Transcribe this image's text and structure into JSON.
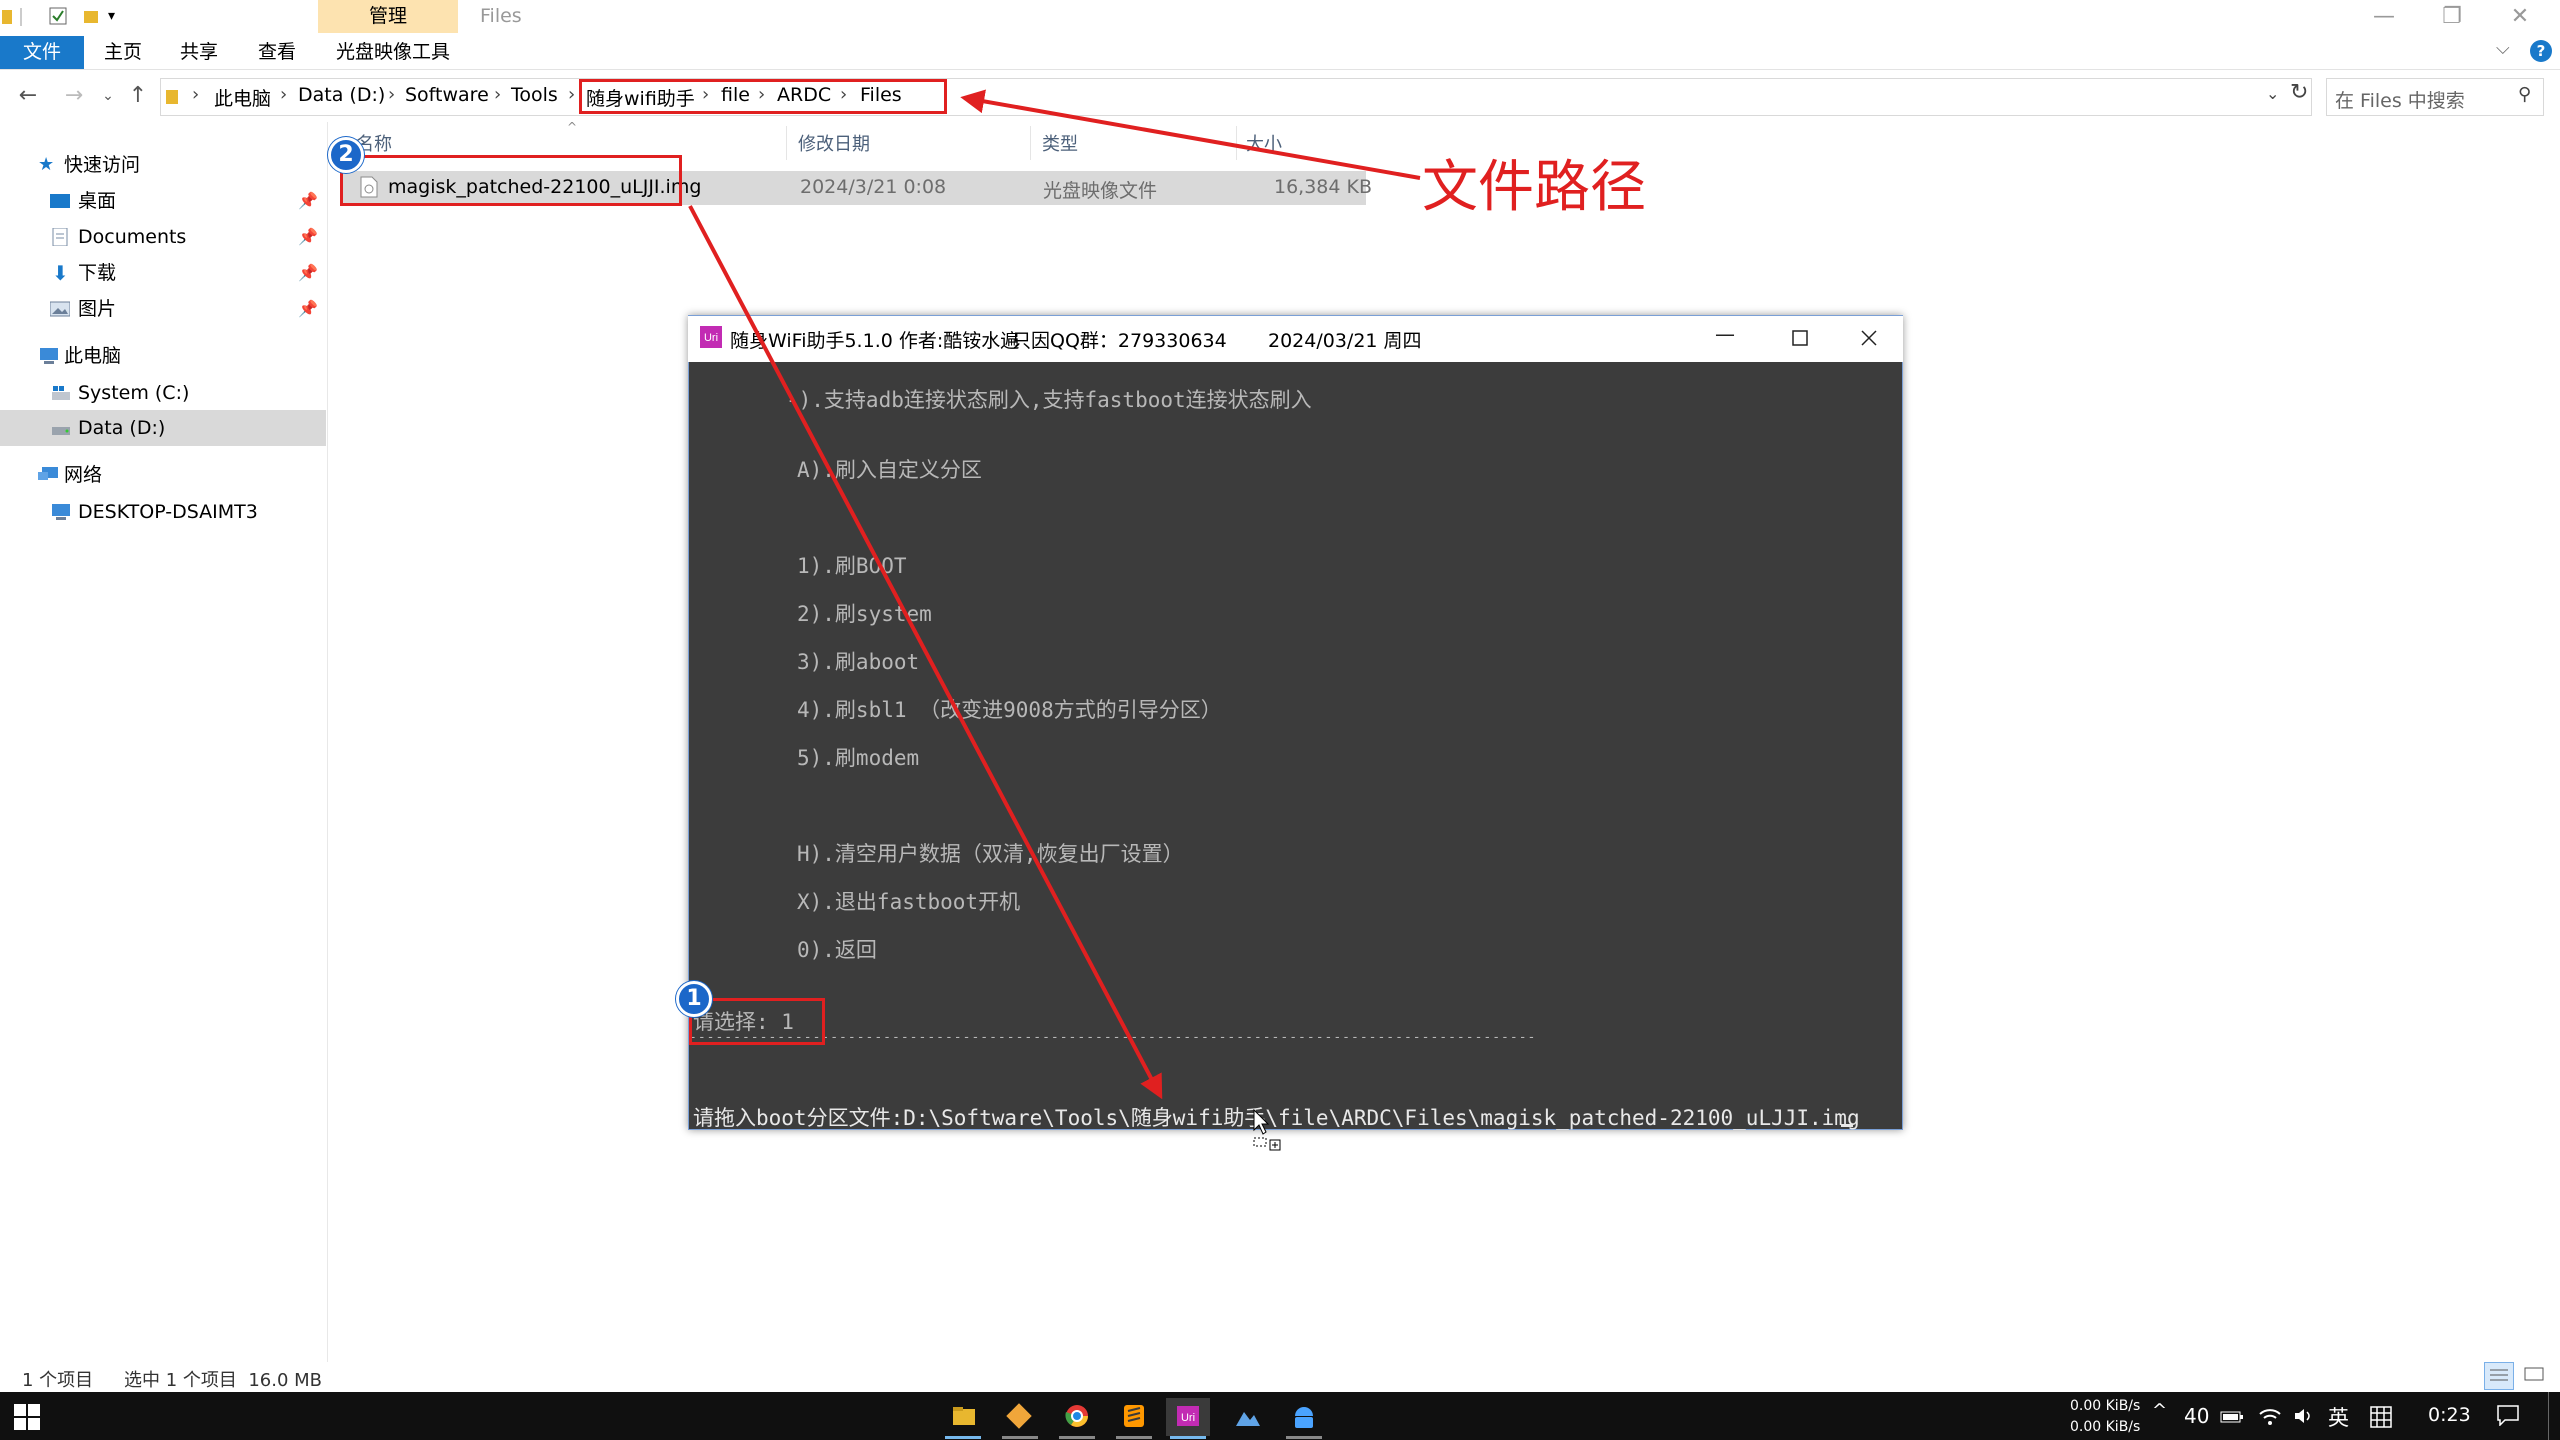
{
  "window": {
    "title": "Files",
    "context_tab": "管理",
    "minimize": "—",
    "restore": "❐",
    "close": "✕"
  },
  "ribbon": {
    "file": "文件",
    "home": "主页",
    "share": "共享",
    "view": "查看",
    "tools": "光盘映像工具"
  },
  "breadcrumb": [
    "此电脑",
    "Data (D:)",
    "Software",
    "Tools",
    "随身wifi助手",
    "file",
    "ARDC",
    "Files"
  ],
  "search": {
    "placeholder": "在 Files 中搜索"
  },
  "nav": {
    "quick_access": "快速访问",
    "desktop": "桌面",
    "documents": "Documents",
    "downloads": "下载",
    "pictures": "图片",
    "this_pc": "此电脑",
    "system_c": "System (C:)",
    "data_d": "Data (D:)",
    "network": "网络",
    "desktop_pc": "DESKTOP-DSAIMT3"
  },
  "columns": {
    "name": "名称",
    "modified": "修改日期",
    "type": "类型",
    "size": "大小"
  },
  "files": [
    {
      "name": "magisk_patched-22100_uLJJI.img",
      "modified": "2024/3/21 0:08",
      "type": "光盘映像文件",
      "size": "16,384 KB"
    }
  ],
  "status": {
    "items": "1 个项目",
    "selected": "选中 1 个项目  16.0 MB"
  },
  "console": {
    "title_app": "随身WiFi助手5.1.0 作者:酷铵水遍",
    "title_qq": "只因QQ群：279330634",
    "title_date": "2024/03/21 周四",
    "lines": {
      "l0": "-).支持adb连接状态刷入,支持fastboot连接状态刷入",
      "l1": "A).刷入自定义分区",
      "l2": "1).刷BOOT",
      "l3": "2).刷system",
      "l4": "3).刷aboot",
      "l5": "4).刷sbl1 （改变进9008方式的引导分区）",
      "l6": "5).刷modem",
      "l7": "H).清空用户数据（双清,恢复出厂设置）",
      "l8": "X).退出fastboot开机",
      "l9": "0).返回",
      "prompt": "请选择: 1",
      "divider": "------------------------------------------------------------------------------------------------",
      "drag": "请拖入boot分区文件:D:\\Software\\Tools\\随身wifi助手\\file\\ARDC\\Files\\magisk_patched-22100_uLJJI.img"
    }
  },
  "annotation": {
    "label": "文件路径",
    "badge1": "1",
    "badge2": "2"
  },
  "tray": {
    "speed_up": "0.00 KiB/s",
    "speed_down": "0.00 KiB/s",
    "temp": "40",
    "ime": "英",
    "time": "0:23"
  },
  "colors": {
    "accent": "#1979ca",
    "annotation_red": "#e02020",
    "console_bg": "#3c3c3c",
    "badge": "#1b67c9"
  }
}
